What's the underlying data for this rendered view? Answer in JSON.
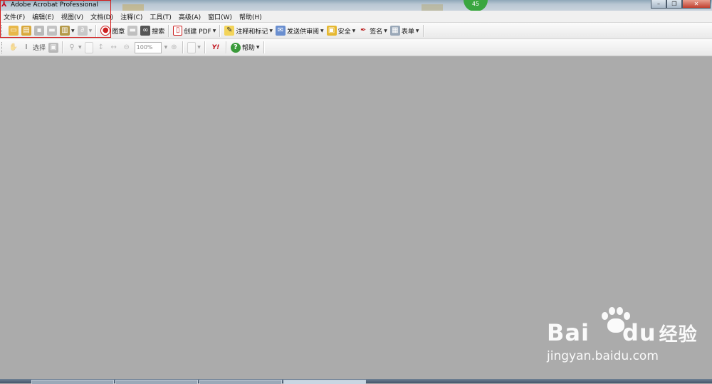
{
  "window": {
    "title": "Adobe Acrobat Professional",
    "app_icon": "acrobat-icon",
    "badge_count": "45",
    "controls": {
      "minimize": "–",
      "restore": "❐",
      "close": "✕"
    }
  },
  "menu": [
    {
      "label": "文件(F)"
    },
    {
      "label": "编辑(E)"
    },
    {
      "label": "视图(V)"
    },
    {
      "label": "文档(D)"
    },
    {
      "label": "注释(C)"
    },
    {
      "label": "工具(T)"
    },
    {
      "label": "高级(A)"
    },
    {
      "label": "窗口(W)"
    },
    {
      "label": "帮助(H)"
    }
  ],
  "toolbar1": {
    "stamp_label": "图章",
    "search_label": "搜索",
    "create_pdf_label": "创建 PDF",
    "comment_label": "注释和标记",
    "review_label": "发送供审阅",
    "security_label": "安全",
    "sign_label": "签名",
    "forms_label": "表单"
  },
  "toolbar2": {
    "select_label": "选择",
    "zoom_value": "100%",
    "help_label": "帮助",
    "yahoo_label": "Y!"
  },
  "watermark": {
    "logo_text": "Bai",
    "logo_text2": "du",
    "logo_cn": "经验",
    "url": "jingyan.baidu.com"
  },
  "colors": {
    "workspace": "#ababab",
    "highlight_border": "#d21b1b",
    "badge": "#3aa640"
  }
}
